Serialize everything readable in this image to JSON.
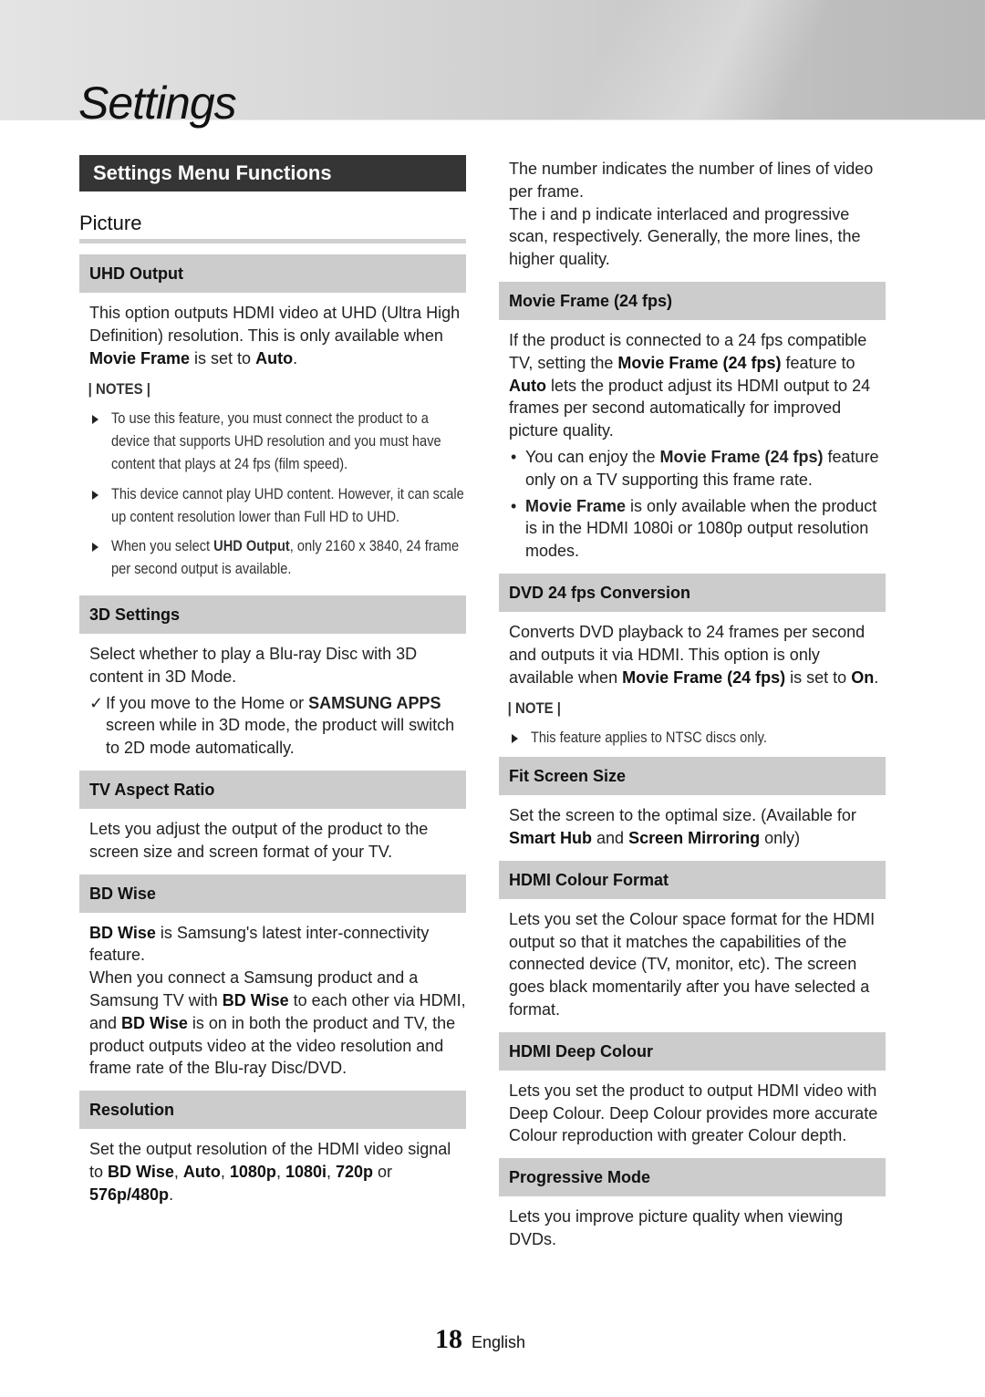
{
  "page": {
    "title": "Settings",
    "section_title": "Settings Menu Functions",
    "subsection_title": "Picture",
    "page_number": "18",
    "language": "English"
  },
  "left": {
    "uhd_output": {
      "heading": "UHD Output",
      "para": [
        {
          "t": "This option outputs HDMI video at UHD (Ultra High Definition) resolution. This is only available when "
        },
        {
          "b": "Movie Frame"
        },
        {
          "t": " is set to "
        },
        {
          "b": "Auto"
        },
        {
          "t": "."
        }
      ],
      "notes_label": "| NOTES |",
      "notes": [
        [
          {
            "t": "To use this feature, you must connect the product to a device that supports UHD resolution and you must have content that plays at 24 fps (film speed)."
          }
        ],
        [
          {
            "t": "This device cannot play UHD content. However, it can scale up content resolution lower than Full HD to UHD."
          }
        ],
        [
          {
            "t": "When you select "
          },
          {
            "b": "UHD Output"
          },
          {
            "t": ", only 2160 x 3840, 24 frame per second output is available."
          }
        ]
      ]
    },
    "settings_3d": {
      "heading": "3D Settings",
      "para": [
        {
          "t": "Select whether to play a Blu-ray Disc with 3D content in 3D Mode."
        }
      ],
      "check_mark": "✓",
      "check": [
        {
          "t": "If you move to the Home or "
        },
        {
          "b": "SAMSUNG APPS"
        },
        {
          "t": " screen while in 3D mode, the product will switch to 2D mode automatically."
        }
      ]
    },
    "tv_aspect_ratio": {
      "heading": "TV Aspect Ratio",
      "para": [
        {
          "t": "Lets you adjust the output of the product to the screen size and screen format of your TV."
        }
      ]
    },
    "bd_wise": {
      "heading": "BD Wise",
      "para": [
        {
          "b": "BD Wise"
        },
        {
          "t": " is Samsung's latest inter-connectivity feature."
        },
        {
          "br": true
        },
        {
          "t": "When you connect a Samsung product and a Samsung TV with "
        },
        {
          "b": "BD Wise"
        },
        {
          "t": " to each other via HDMI, and "
        },
        {
          "b": "BD Wise"
        },
        {
          "t": " is on in both the product and TV, the product outputs video at the video resolution and frame rate of the Blu-ray Disc/DVD."
        }
      ]
    },
    "resolution": {
      "heading": "Resolution",
      "para": [
        {
          "t": "Set the output resolution of the HDMI video signal to "
        },
        {
          "b": "BD Wise"
        },
        {
          "t": ", "
        },
        {
          "b": "Auto"
        },
        {
          "t": ", "
        },
        {
          "b": "1080p"
        },
        {
          "t": ", "
        },
        {
          "b": "1080i"
        },
        {
          "t": ", "
        },
        {
          "b": "720p"
        },
        {
          "t": " or "
        },
        {
          "b": "576p/480p"
        },
        {
          "t": "."
        }
      ]
    }
  },
  "right": {
    "resolution_cont": {
      "para": [
        {
          "t": "The number indicates the number of lines of video per frame."
        },
        {
          "br": true
        },
        {
          "t": "The i and p indicate interlaced and progressive scan, respectively. Generally, the more lines, the higher quality."
        }
      ]
    },
    "movie_frame": {
      "heading": "Movie Frame (24 fps)",
      "para": [
        {
          "t": "If the product is connected to a 24 fps compatible TV, setting the "
        },
        {
          "b": "Movie Frame (24 fps)"
        },
        {
          "t": " feature to "
        },
        {
          "b": "Auto"
        },
        {
          "t": " lets the product adjust its HDMI output to 24 frames per second automatically for improved picture quality."
        }
      ],
      "bullet_char": "•",
      "bullets": [
        [
          {
            "t": "You can enjoy the "
          },
          {
            "b": "Movie Frame (24 fps)"
          },
          {
            "t": " feature only on a TV supporting this frame rate."
          }
        ],
        [
          {
            "b": "Movie Frame"
          },
          {
            "t": " is only available when the product is in the HDMI 1080i or 1080p output resolution modes."
          }
        ]
      ]
    },
    "dvd_24fps": {
      "heading": "DVD 24 fps Conversion",
      "para": [
        {
          "t": "Converts DVD playback to 24 frames per second and outputs it via HDMI. This option is only available when "
        },
        {
          "b": "Movie Frame (24 fps)"
        },
        {
          "t": " is set to "
        },
        {
          "b": "On"
        },
        {
          "t": "."
        }
      ],
      "notes_label": "| NOTE |",
      "notes": [
        [
          {
            "t": "This feature applies to NTSC discs only."
          }
        ]
      ]
    },
    "fit_screen": {
      "heading": "Fit Screen Size",
      "para": [
        {
          "t": "Set the screen to the optimal size. (Available for "
        },
        {
          "b": "Smart Hub"
        },
        {
          "t": " and "
        },
        {
          "b": "Screen Mirroring"
        },
        {
          "t": " only)"
        }
      ]
    },
    "hdmi_colour_format": {
      "heading": "HDMI Colour Format",
      "para": [
        {
          "t": "Lets you set the Colour space format for the HDMI output so that it matches the capabilities of the connected device (TV, monitor, etc). The screen goes black momentarily after you have selected a format."
        }
      ]
    },
    "hdmi_deep_colour": {
      "heading": "HDMI Deep Colour",
      "para": [
        {
          "t": "Lets you set the product to output HDMI video with Deep Colour. Deep Colour provides more accurate Colour reproduction with greater Colour depth."
        }
      ]
    },
    "progressive_mode": {
      "heading": "Progressive Mode",
      "para": [
        {
          "t": "Lets you improve picture quality when viewing DVDs."
        }
      ]
    }
  }
}
